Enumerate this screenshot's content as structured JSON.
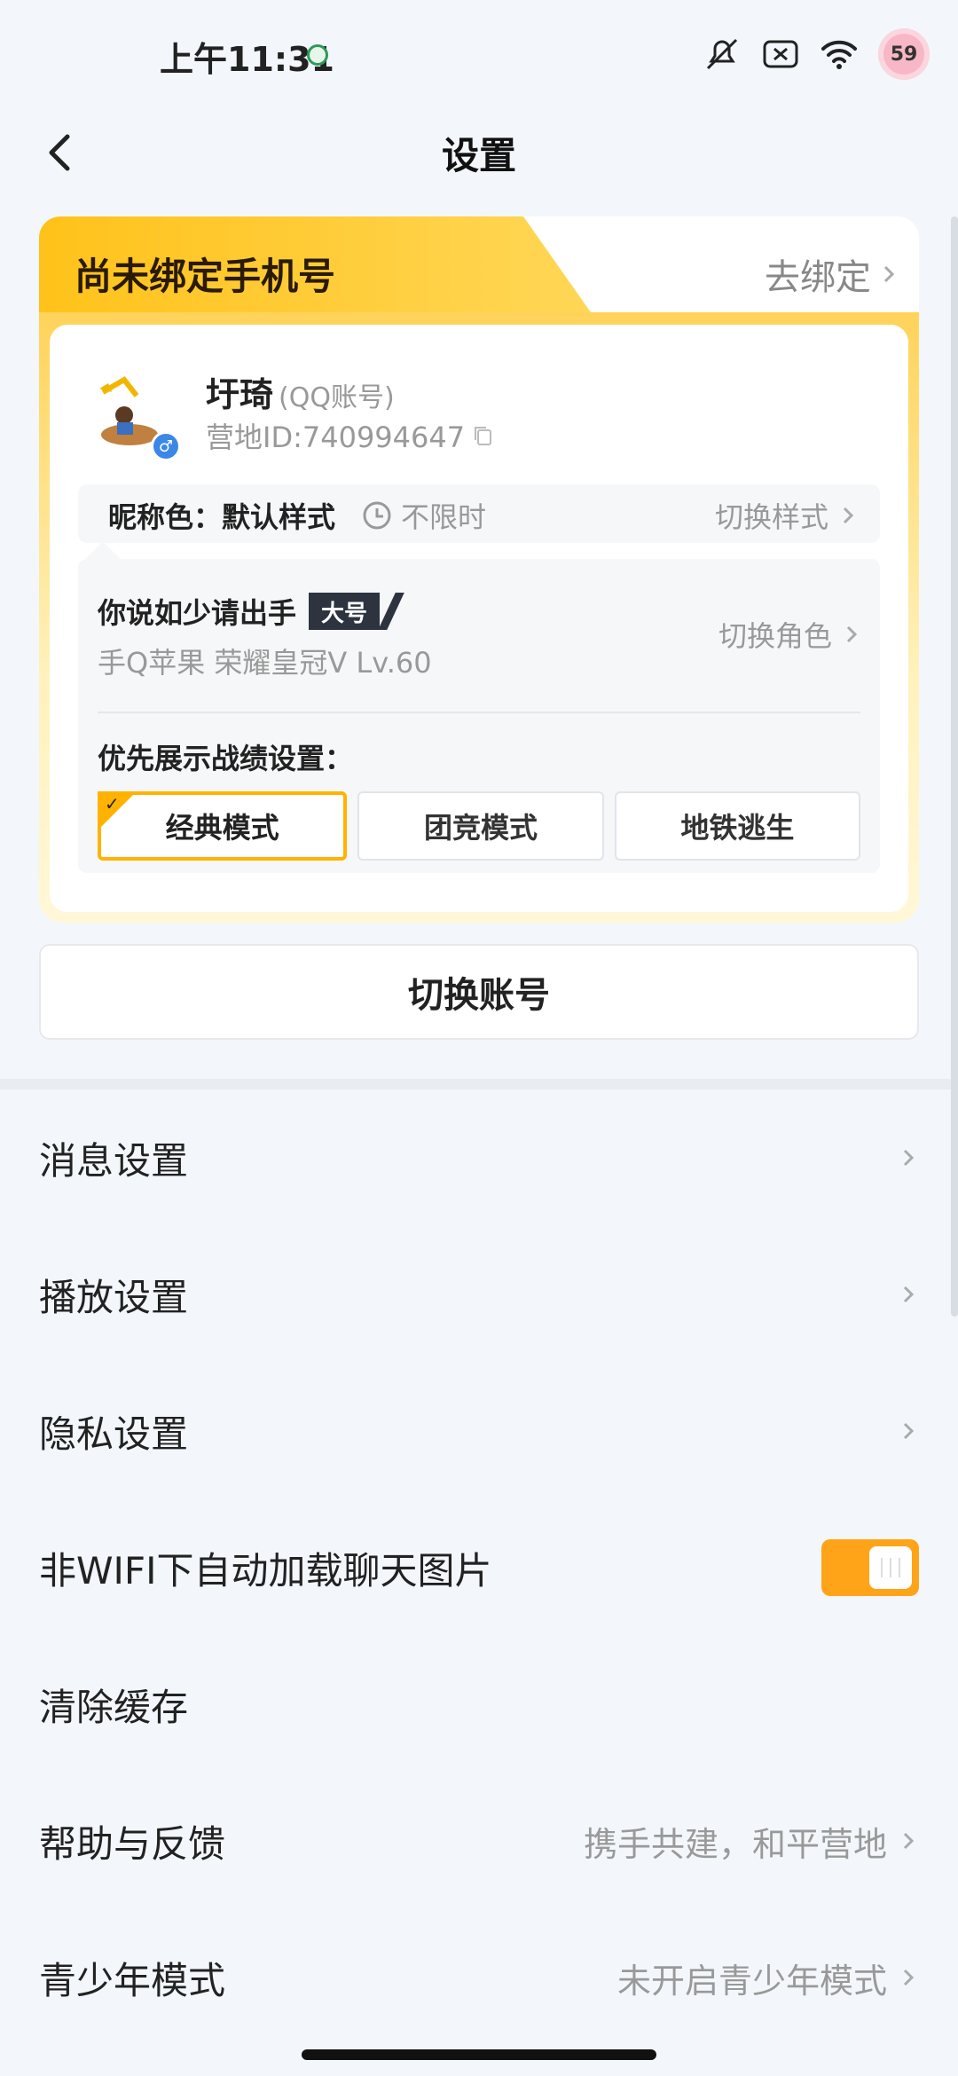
{
  "status": {
    "time": "上午11:31",
    "battery": "59"
  },
  "header": {
    "title": "设置"
  },
  "account_card": {
    "tab_label": "尚未绑定手机号",
    "bind_action": "去绑定",
    "user_name": "圩琦",
    "user_tag": "(QQ账号)",
    "camp_id": "营地ID:740994647",
    "nick_color_label": "昵称色：默认样式",
    "nick_duration": "不限时",
    "switch_style": "切换样式",
    "role": {
      "name": "你说如少请出手",
      "badge": "大号",
      "subtitle": "手Q苹果  荣耀皇冠V  Lv.60",
      "switch_role": "切换角色"
    },
    "pref_label": "优先展示战绩设置：",
    "modes": [
      {
        "label": "经典模式",
        "active": true
      },
      {
        "label": "团竞模式",
        "active": false
      },
      {
        "label": "地铁逃生",
        "active": false
      }
    ]
  },
  "switch_account": "切换账号",
  "settings": [
    {
      "label": "消息设置",
      "right": ""
    },
    {
      "label": "播放设置",
      "right": ""
    },
    {
      "label": "隐私设置",
      "right": ""
    },
    {
      "label": "非WIFI下自动加载聊天图片",
      "toggle": true
    },
    {
      "label": "清除缓存",
      "right": ""
    },
    {
      "label": "帮助与反馈",
      "right": "携手共建，和平营地"
    },
    {
      "label": "青少年模式",
      "right": "未开启青少年模式"
    }
  ],
  "colors": {
    "accent": "#ffa418",
    "card_yellow": "#ffd35a",
    "text": "#222222",
    "muted": "#999999",
    "background": "#f3f7fb"
  }
}
